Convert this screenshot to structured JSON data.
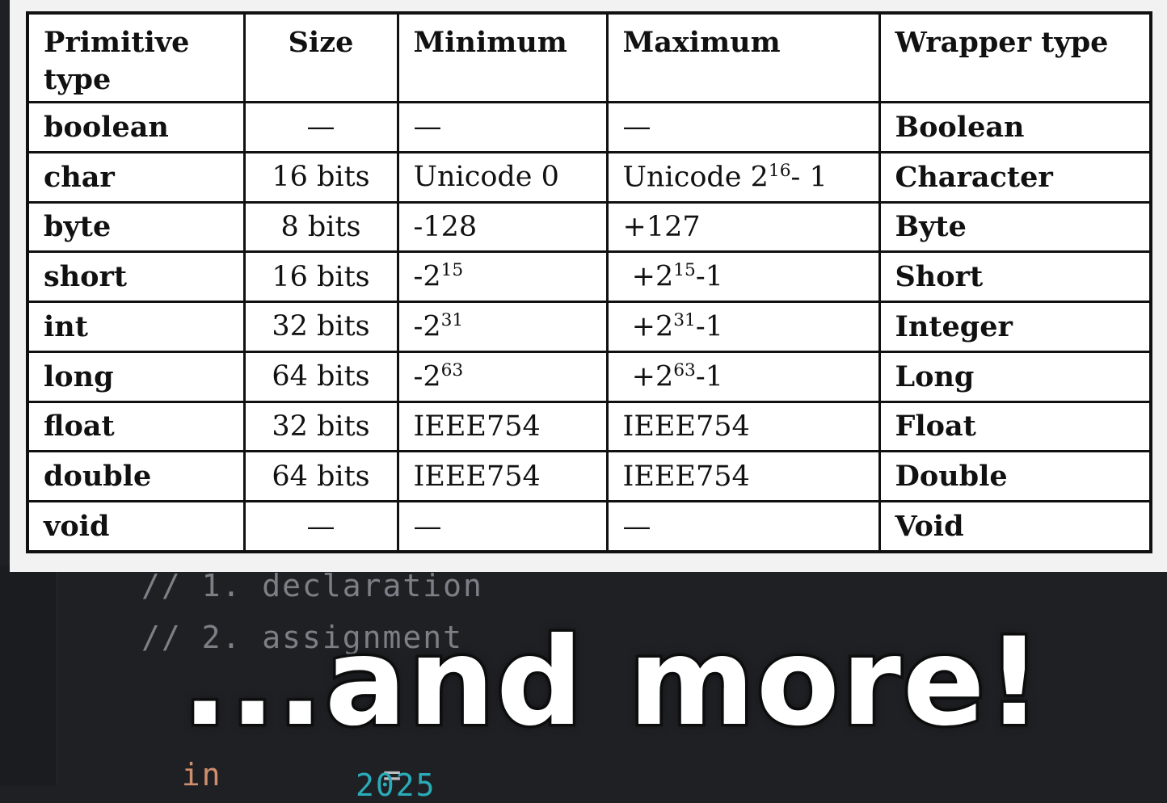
{
  "code": {
    "comment_1": "// 1. declaration",
    "comment_2": "// 2. assignment",
    "line_3_keyword": "in",
    "line_3_op": "=",
    "line_4_num": "2025"
  },
  "table": {
    "headers": {
      "type": "Primitive type",
      "size": "Size",
      "min": "Minimum",
      "max": "Maximum",
      "wrapper": "Wrapper type"
    },
    "rows": [
      {
        "type": "boolean",
        "size": "—",
        "min": "—",
        "max": "—",
        "wrapper": "Boolean"
      },
      {
        "type": "char",
        "size": "16 bits",
        "min": "Unicode 0",
        "max_base": "Unicode 2",
        "max_exp": "16",
        "max_rest": "- 1",
        "wrapper": "Character"
      },
      {
        "type": "byte",
        "size": "8 bits",
        "min": "-128",
        "max": "+127",
        "wrapper": "Byte"
      },
      {
        "type": "short",
        "size": "16 bits",
        "min_base": "-2",
        "min_exp": "15",
        "max_base": "+2",
        "max_exp": "15",
        "max_rest": "-1",
        "wrapper": "Short"
      },
      {
        "type": "int",
        "size": "32 bits",
        "min_base": "-2",
        "min_exp": "31",
        "max_base": "+2",
        "max_exp": "31",
        "max_rest": "-1",
        "wrapper": "Integer"
      },
      {
        "type": "long",
        "size": "64 bits",
        "min_base": "-2",
        "min_exp": "63",
        "max_base": "+2",
        "max_exp": "63",
        "max_rest": "-1",
        "wrapper": "Long"
      },
      {
        "type": "float",
        "size": "32 bits",
        "min": "IEEE754",
        "max": "IEEE754",
        "wrapper": "Float"
      },
      {
        "type": "double",
        "size": "64 bits",
        "min": "IEEE754",
        "max": "IEEE754",
        "wrapper": "Double"
      },
      {
        "type": "void",
        "size": "—",
        "min": "—",
        "max": "—",
        "wrapper": "Void"
      }
    ]
  },
  "overlay": {
    "text": "...and more!"
  },
  "colors": {
    "editor_bg": "#1f2024",
    "comment": "#7c7f86",
    "keyword": "#cf8e6d",
    "slide_bg": "#f2f2f2",
    "table_border": "#111111"
  }
}
